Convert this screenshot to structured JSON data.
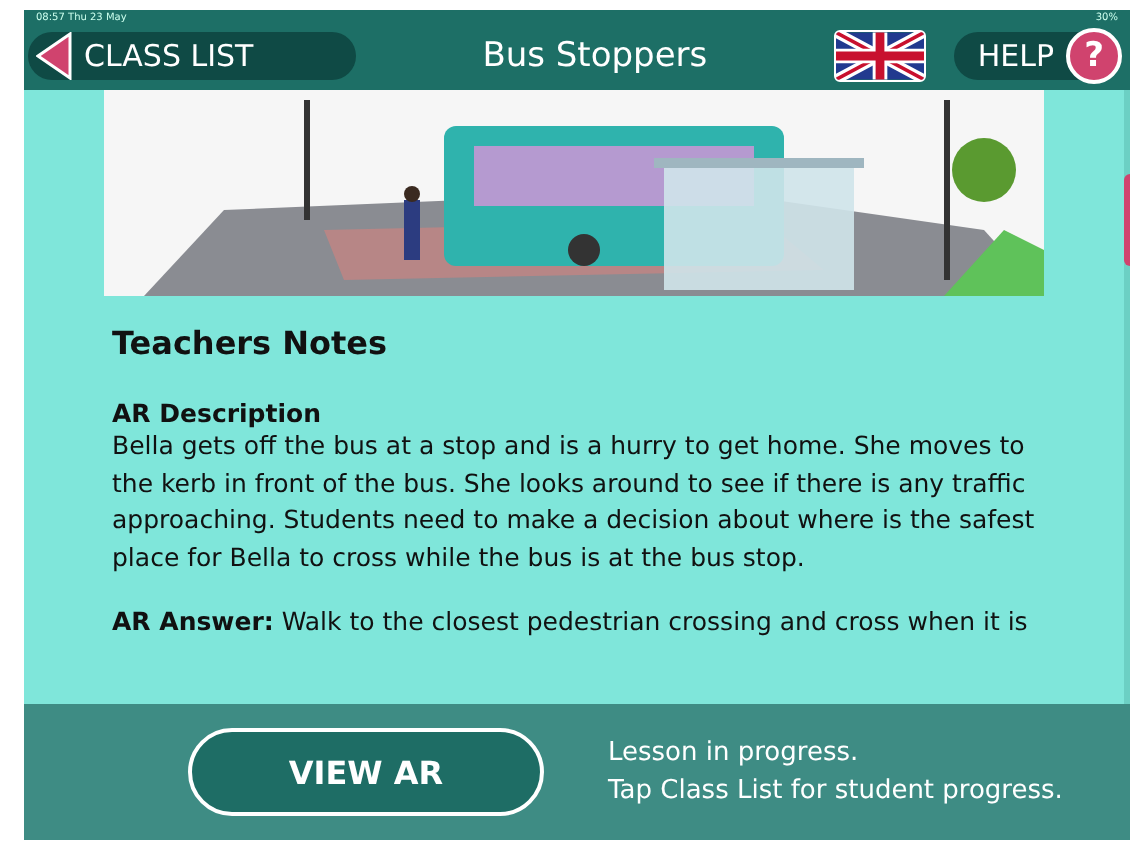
{
  "status_bar": {
    "time": "08:57",
    "date": "Thu 23 May",
    "battery": "30%"
  },
  "header": {
    "back": "CLASS LIST",
    "title": "Bus Stoppers",
    "help": "HELP",
    "help_icon": "?"
  },
  "notes": {
    "heading": "Teachers Notes",
    "sections": [
      {
        "title": "AR Description",
        "body": "Bella gets off the bus at a stop and is a hurry to get home. She moves to the kerb in front of the bus. She looks around to see if there is any traffic approaching. Students need to make a decision about where is the safest place for Bella to cross while the bus is at the bus stop."
      },
      {
        "inline": "**AR Answer:** Walk to the closest pedestrian crossing and cross when it is"
      }
    ]
  },
  "footer": {
    "button": "VIEW AR",
    "status": [
      "Lesson in progress.",
      "Tap Class List for student progress."
    ]
  }
}
